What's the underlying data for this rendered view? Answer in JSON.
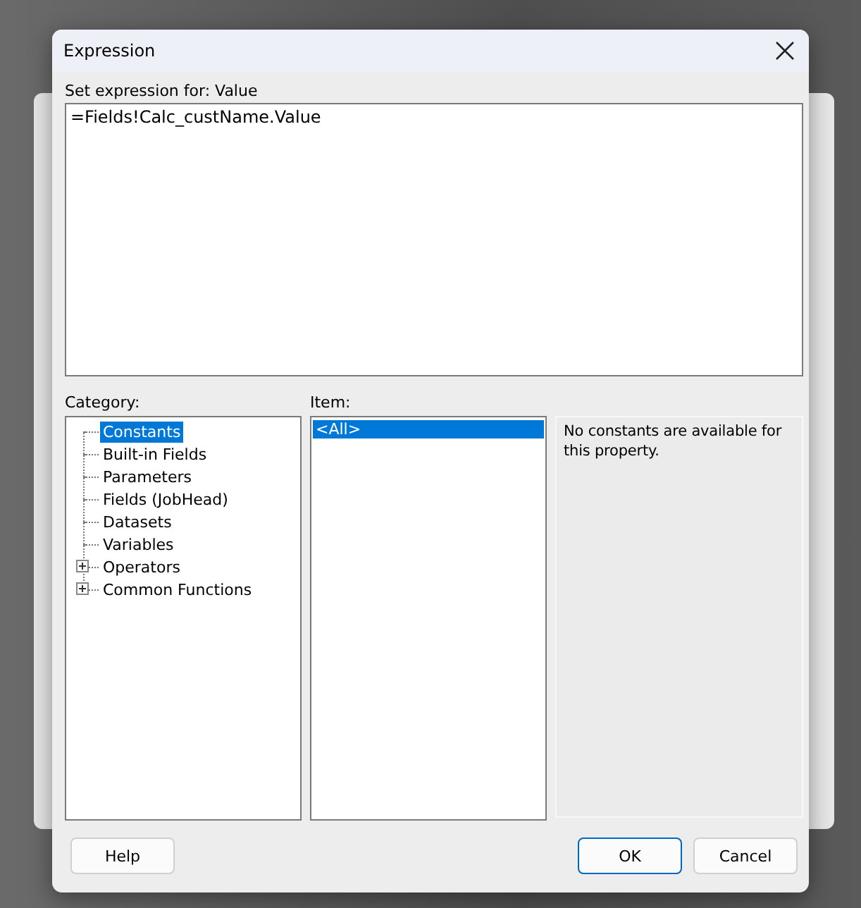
{
  "window": {
    "title": "Expression"
  },
  "expression_label": "Set expression for: Value",
  "expression": {
    "value": "=Fields!Calc_custName.Value"
  },
  "category": {
    "label": "Category:",
    "items": [
      {
        "label": "Constants",
        "selected": true,
        "expandable": false
      },
      {
        "label": "Built-in Fields",
        "selected": false,
        "expandable": false
      },
      {
        "label": "Parameters",
        "selected": false,
        "expandable": false
      },
      {
        "label": "Fields (JobHead)",
        "selected": false,
        "expandable": false
      },
      {
        "label": "Datasets",
        "selected": false,
        "expandable": false
      },
      {
        "label": "Variables",
        "selected": false,
        "expandable": false
      },
      {
        "label": "Operators",
        "selected": false,
        "expandable": true
      },
      {
        "label": "Common Functions",
        "selected": false,
        "expandable": true
      }
    ]
  },
  "item": {
    "label": "Item:",
    "items": [
      {
        "label": "<All>",
        "selected": true
      }
    ]
  },
  "description": "No constants are available for this property.",
  "buttons": [
    {
      "label": "Help",
      "kind": "left",
      "default": false
    },
    {
      "label": "OK",
      "kind": "right",
      "default": true
    },
    {
      "label": "Cancel",
      "kind": "right",
      "default": false
    }
  ]
}
